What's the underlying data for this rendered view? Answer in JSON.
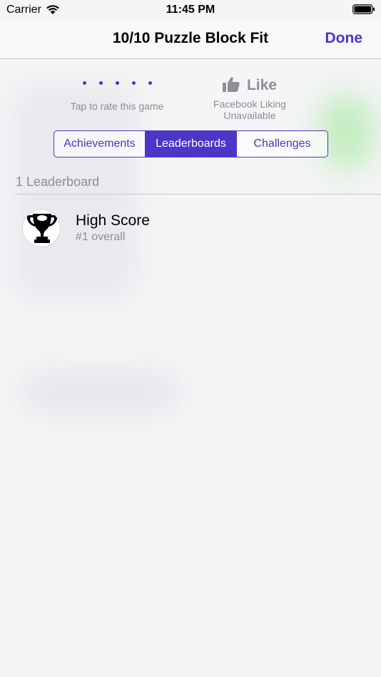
{
  "status_bar": {
    "carrier": "Carrier",
    "time": "11:45 PM"
  },
  "nav": {
    "title": "10/10 Puzzle Block Fit",
    "done_label": "Done"
  },
  "rating": {
    "prompt": "Tap to rate this game",
    "star_count": 5
  },
  "like": {
    "label": "Like",
    "status_line1": "Facebook Liking",
    "status_line2": "Unavailable"
  },
  "segments": [
    {
      "label": "Achievements",
      "active": false
    },
    {
      "label": "Leaderboards",
      "active": true
    },
    {
      "label": "Challenges",
      "active": false
    }
  ],
  "section": {
    "header": "1 Leaderboard"
  },
  "leaderboards": [
    {
      "title": "High Score",
      "rank": "#1 overall",
      "icon": "trophy-icon"
    }
  ],
  "colors": {
    "accent": "#4a37c8",
    "secondary_text": "#8e8e93"
  }
}
